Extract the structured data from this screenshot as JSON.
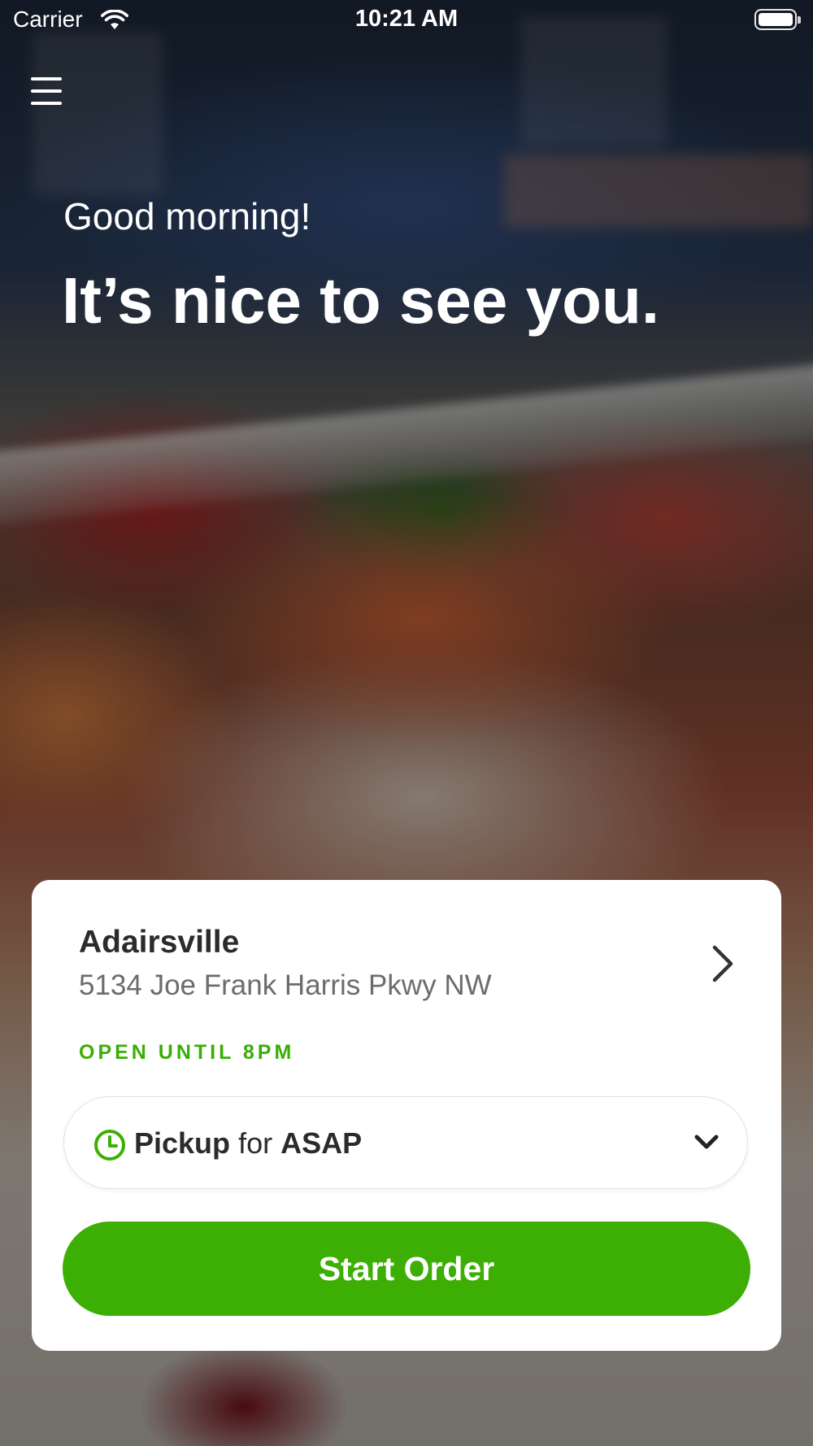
{
  "status_bar": {
    "carrier": "Carrier",
    "time": "10:21 AM",
    "wifi_icon": "wifi-icon",
    "battery_icon": "battery-icon"
  },
  "header": {
    "menu_icon": "hamburger-menu-icon",
    "greeting": "Good morning!",
    "headline": "It’s nice to see you."
  },
  "location_card": {
    "name": "Adairsville",
    "address": "5134 Joe Frank Harris Pkwy NW",
    "hours": "OPEN UNTIL 8PM",
    "chevron_icon": "chevron-right-icon"
  },
  "pickup_select": {
    "mode": "Pickup",
    "connector": "for",
    "time": "ASAP",
    "clock_icon": "clock-icon",
    "dropdown_icon": "chevron-down-icon"
  },
  "actions": {
    "start_order": "Start Order"
  },
  "colors": {
    "accent_green": "#3daf04",
    "hours_green": "#3aae07",
    "card_background": "#ffffff",
    "text_dark": "#2b2b2b",
    "text_secondary": "#6c6c6c"
  }
}
